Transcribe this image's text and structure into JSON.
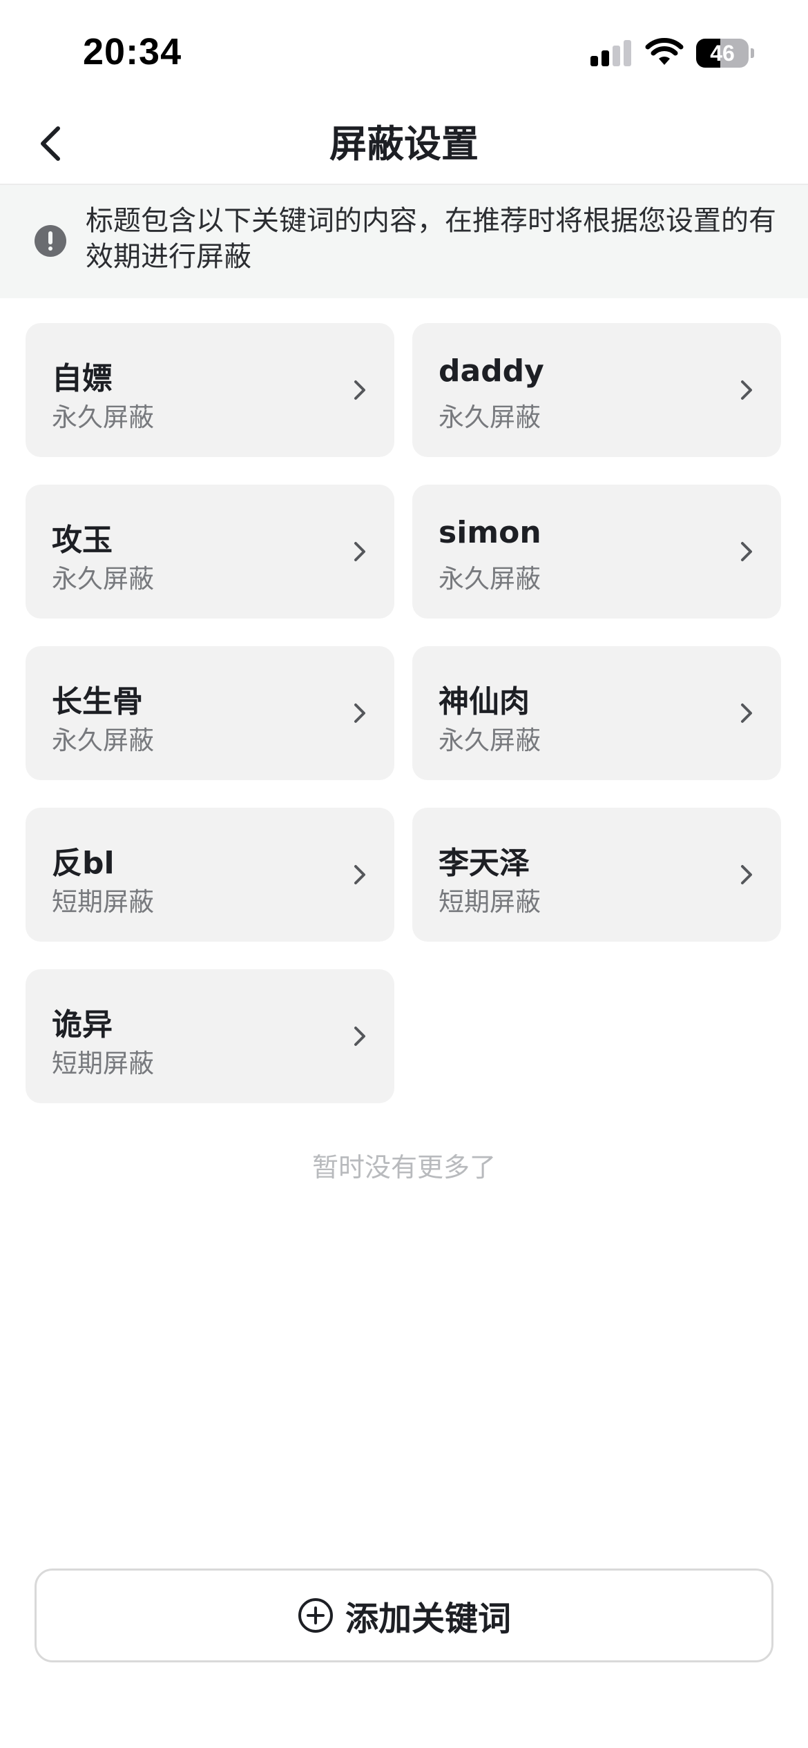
{
  "status_bar": {
    "time": "20:34",
    "battery": "46"
  },
  "nav": {
    "title": "屏蔽设置"
  },
  "notice": {
    "text": "标题包含以下关键词的内容，在推荐时将根据您设置的有效期进行屏蔽"
  },
  "keywords": [
    {
      "name": "自嫖",
      "period": "永久屏蔽"
    },
    {
      "name": "daddy",
      "period": "永久屏蔽"
    },
    {
      "name": "攻玉",
      "period": "永久屏蔽"
    },
    {
      "name": "simon",
      "period": "永久屏蔽"
    },
    {
      "name": "长生骨",
      "period": "永久屏蔽"
    },
    {
      "name": "神仙肉",
      "period": "永久屏蔽"
    },
    {
      "name": "反bl",
      "period": "短期屏蔽"
    },
    {
      "name": "李天泽",
      "period": "短期屏蔽"
    },
    {
      "name": "诡异",
      "period": "短期屏蔽"
    }
  ],
  "list_end_text": "暂时没有更多了",
  "add_button": {
    "label": "添加关键词"
  }
}
